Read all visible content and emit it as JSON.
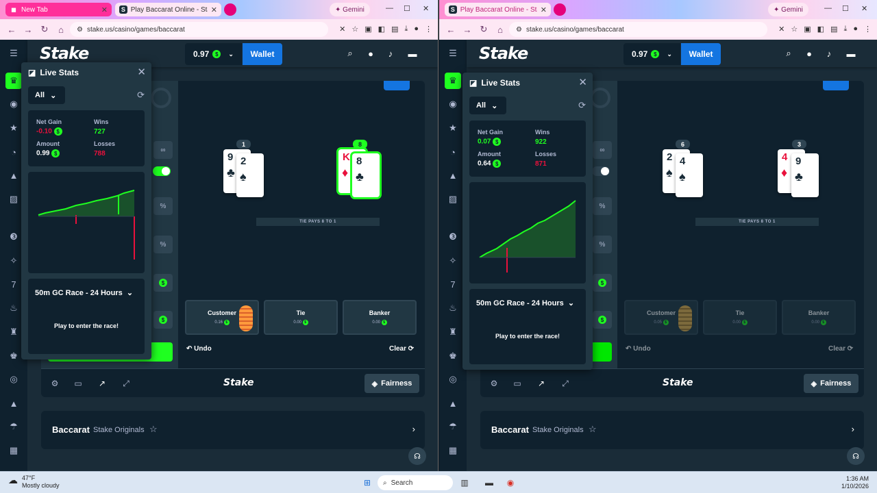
{
  "left": {
    "tabs": [
      {
        "title": "New Tab"
      },
      {
        "title": "Play Baccarat Online - Stake Or"
      }
    ],
    "gemini": "Gemini",
    "url": "stake.us/casino/games/baccarat",
    "balance": "0.97",
    "wallet": "Wallet",
    "stats": {
      "title": "Live Stats",
      "filter": "All",
      "net_gain_label": "Net Gain",
      "net_gain": "-0.10",
      "wins_label": "Wins",
      "wins": "727",
      "amount_label": "Amount",
      "amount": "0.99",
      "losses_label": "Losses",
      "losses": "788",
      "race": "50m GC Race - 24 Hours",
      "play": "Play to enter the race!"
    },
    "game": {
      "player_score": "1",
      "banker_score": "8",
      "player_cards": [
        {
          "rank": "9",
          "suit": "♣",
          "color": "black"
        },
        {
          "rank": "2",
          "suit": "♠",
          "color": "black"
        }
      ],
      "banker_cards": [
        {
          "rank": "K",
          "suit": "♦",
          "color": "red"
        },
        {
          "rank": "8",
          "suit": "♣",
          "color": "black"
        }
      ],
      "tie_pays": "TIE PAYS 8 TO 1",
      "spots": [
        {
          "label": "Customer",
          "amount": "0.16"
        },
        {
          "label": "Tie",
          "amount": "0.00"
        },
        {
          "label": "Banker",
          "amount": "0.00"
        }
      ],
      "undo": "Undo",
      "clear": "Clear"
    },
    "fairness": "Fairness",
    "footer_logo": "Stake",
    "title": "Baccarat",
    "subtitle": "Stake Originals"
  },
  "right": {
    "tabs": [
      {
        "title": "Play Baccarat Online - Stake"
      }
    ],
    "gemini": "Gemini",
    "url": "stake.us/casino/games/baccarat",
    "balance": "0.97",
    "wallet": "Wallet",
    "stats": {
      "title": "Live Stats",
      "filter": "All",
      "net_gain_label": "Net Gain",
      "net_gain": "0.07",
      "wins_label": "Wins",
      "wins": "922",
      "amount_label": "Amount",
      "amount": "0.64",
      "losses_label": "Losses",
      "losses": "871",
      "race": "50m GC Race - 24 Hours",
      "play": "Play to enter the race!"
    },
    "game": {
      "player_score": "6",
      "banker_score": "3",
      "player_cards": [
        {
          "rank": "2",
          "suit": "♠",
          "color": "black"
        },
        {
          "rank": "4",
          "suit": "♠",
          "color": "black"
        }
      ],
      "banker_cards": [
        {
          "rank": "4",
          "suit": "♦",
          "color": "red"
        },
        {
          "rank": "9",
          "suit": "♣",
          "color": "black"
        }
      ],
      "tie_pays": "TIE PAYS 8 TO 1",
      "spots": [
        {
          "label": "Customer",
          "amount": "0.05"
        },
        {
          "label": "Tie",
          "amount": "0.00"
        },
        {
          "label": "Banker",
          "amount": "0.00"
        }
      ],
      "undo": "Undo",
      "clear": "Clear"
    },
    "fairness": "Fairness",
    "footer_logo": "Stake",
    "title": "Baccarat",
    "subtitle": "Stake Originals"
  },
  "brand": "Stake",
  "taskbar": {
    "temp": "47°F",
    "weather": "Mostly cloudy",
    "search": "Search",
    "time": "1:36 AM",
    "date": "1/10/2026"
  },
  "colors": {
    "accent": "#1fff20",
    "negative": "#e9113c",
    "wallet": "#1475e1",
    "bg": "#1a2c38"
  }
}
